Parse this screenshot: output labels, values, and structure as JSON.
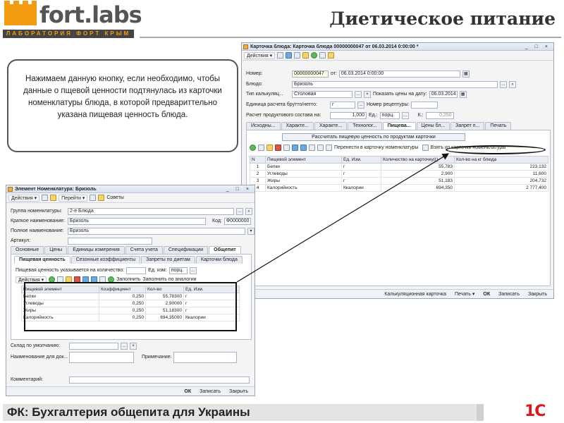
{
  "header": {
    "logo_main": "fort.labs",
    "logo_sub": "ЛАБОРАТОРИЯ ФОРТ КРЫМ",
    "title": "Диетическое питание"
  },
  "callout": {
    "text": "Нажимаем данную кнопку, если необходимо, чтобы данные о пщевой ценности подтянулась из карточки номенклатуры блюда, в которой предвариттельно указана пищевая ценность блюда."
  },
  "dish_card": {
    "title": "Карточка блюда: Карточка блюда 00000000047 от 06.03.2014 0:00:00 *",
    "window_controls": "_ □ ×",
    "toolbar": {
      "actions": "Действия ▾"
    },
    "fields": {
      "number_label": "Номер:",
      "number_value": "00000000047",
      "from_label": "от:",
      "date_value": "06.03.2014  0:00:00",
      "dish_label": "Блюдо:",
      "dish_value": "Бризоль",
      "calc_type_label": "Тип калькуляц...",
      "calc_type_value": "Столовая",
      "show_prices_label": "Показать цены на дату:",
      "show_prices_value": "06.03.2014",
      "unit_label": "Единица расчета брутто/нетто:",
      "unit_value": "г",
      "recipe_label": "Номер рецептуры:",
      "product_calc_label": "Расчет продуктового состава на:",
      "product_calc_value": "1,000",
      "ed_label": "Ед.:",
      "ed_value": "порц.",
      "k_label": "К.:",
      "k_value": "0,250"
    },
    "tabs": [
      "Исходны...",
      "Характе...",
      "Характе...",
      "Технолог...",
      "Пищева...",
      "Цены бл...",
      "Запрет п...",
      "Печать"
    ],
    "active_tab_index": 4,
    "calc_button": "Рассчитать пищевую ценность по продуктам карточки",
    "transfer_label": "Перенести в карточку номенклатуры",
    "fetch_button": "Взять из карточки номенклатуры",
    "table": {
      "headers": [
        "N",
        "Пищевой элемент",
        "Ед. Изм.",
        "Количество на карточку(г)",
        "Кол-во на кг блюда"
      ],
      "rows": [
        [
          "1",
          "Белки",
          "г",
          "55,783",
          "223,132"
        ],
        [
          "2",
          "Углеводы",
          "г",
          "2,900",
          "11,600"
        ],
        [
          "3",
          "Жиры",
          "г",
          "51,183",
          "204,732"
        ],
        [
          "4",
          "Калорийность",
          "Ккалории",
          "694,350",
          "2 777,400"
        ]
      ]
    },
    "status": {
      "calc_card": "Калькуляционная карточка",
      "print": "Печать ▾",
      "ok": "ОК",
      "save": "Записать",
      "close": "Закрыть"
    }
  },
  "nomenclature": {
    "title": "Элемент Номенклатура: Бризоль",
    "window_controls": "_ □ ×",
    "toolbar": {
      "actions": "Действия ▾",
      "go": "Перейти ▾",
      "tips": "Советы"
    },
    "fields": {
      "group_label": "Группа номенклатуры:",
      "group_value": "2-е Блюда",
      "short_label": "Краткое наименование:",
      "short_value": "Бризоль",
      "code_label": "Код:",
      "code_value": "Ф0000000",
      "full_label": "Полное наименование:",
      "full_value": "Бризоль",
      "article_label": "Артикул:"
    },
    "tabs_top": [
      "Основные",
      "Цены",
      "Единицы измерения",
      "Счета учета",
      "Спецификации",
      "Общепит"
    ],
    "active_top_index": 5,
    "tabs_sub": [
      "Пищевая ценность",
      "Сезонные коэффициенты",
      "Запреты по диетам",
      "Карточки блюда"
    ],
    "active_sub_index": 0,
    "qty_label": "Пищевая ценность указывается на количество:",
    "qty_unit_label": "Ед. изм:",
    "qty_unit_value": "порц.",
    "sub_toolbar": {
      "actions": "Действия ▾",
      "fill": "Заполнить",
      "fill_analog": "Заполнить по аналогии"
    },
    "table": {
      "headers": [
        "Пищевой элемент",
        "Коэффициент",
        "Кол-во",
        "Ед. Изм."
      ],
      "rows": [
        [
          "Белки",
          "0,250",
          "55,78300",
          "г"
        ],
        [
          "Углеводы",
          "0,250",
          "2,90000",
          "г"
        ],
        [
          "Жиры",
          "0,250",
          "51,18300",
          "г"
        ],
        [
          "Калорийность",
          "0,250",
          "694,35000",
          "Ккалории"
        ]
      ]
    },
    "bottom": {
      "warehouse_label": "Склад по умолчанию:",
      "doc_name_label": "Наименование для док...",
      "note_label": "Примечание:",
      "comment_label": "Комментарий:"
    },
    "status": {
      "ok": "ОК",
      "save": "Записать",
      "close": "Закрыть"
    }
  },
  "footer": {
    "text": "ФК: Бухгалтерия общепита для Украины",
    "logo": "1С"
  }
}
